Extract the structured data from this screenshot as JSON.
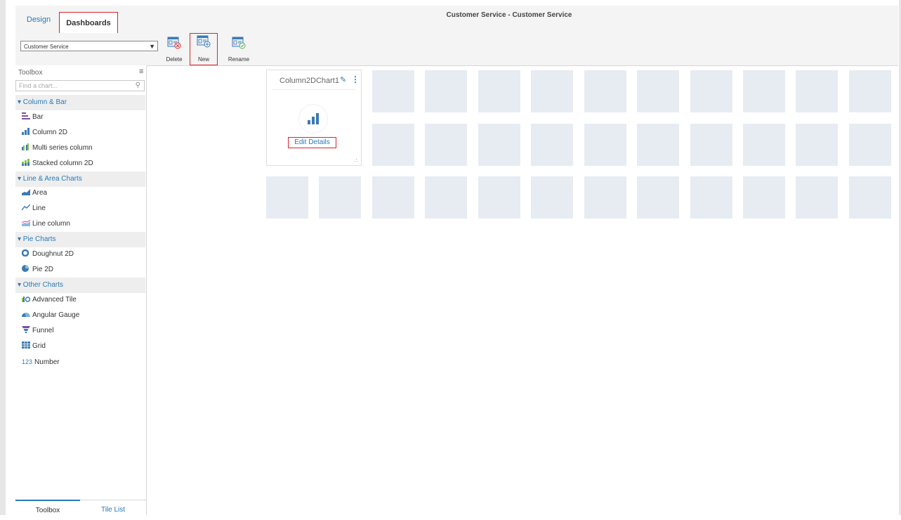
{
  "header": {
    "tabs": [
      {
        "label": "Design"
      },
      {
        "label": "Dashboards"
      }
    ],
    "title": "Customer Service - Customer Service"
  },
  "toolbar": {
    "dashboard_select": "Customer Service",
    "buttons": [
      {
        "label": "Delete"
      },
      {
        "label": "New"
      },
      {
        "label": "Rename"
      }
    ]
  },
  "sidebar": {
    "header": "Toolbox",
    "search_placeholder": "Find a chart...",
    "groups": [
      {
        "label": "▾ Column & Bar",
        "items": [
          {
            "label": "Bar",
            "icon": "bar-chart-icon"
          },
          {
            "label": "Column 2D",
            "icon": "column-chart-icon"
          },
          {
            "label": "Multi series column",
            "icon": "multi-series-column-icon"
          },
          {
            "label": "Stacked column 2D",
            "icon": "stacked-column-icon"
          }
        ]
      },
      {
        "label": "▾ Line & Area Charts",
        "items": [
          {
            "label": "Area",
            "icon": "area-chart-icon"
          },
          {
            "label": "Line",
            "icon": "line-chart-icon"
          },
          {
            "label": "Line column",
            "icon": "line-column-icon"
          }
        ]
      },
      {
        "label": "▾ Pie Charts",
        "items": [
          {
            "label": "Doughnut 2D",
            "icon": "doughnut-chart-icon"
          },
          {
            "label": "Pie 2D",
            "icon": "pie-chart-icon"
          }
        ]
      },
      {
        "label": "▾ Other Charts",
        "items": [
          {
            "label": "Advanced Tile",
            "icon": "advanced-tile-icon"
          },
          {
            "label": "Angular Gauge",
            "icon": "gauge-icon"
          },
          {
            "label": "Funnel",
            "icon": "funnel-icon"
          },
          {
            "label": "Grid",
            "icon": "grid-icon"
          },
          {
            "label": "Number",
            "icon": "number-icon"
          }
        ]
      }
    ],
    "number_glyph": "123",
    "bottom_tabs": [
      {
        "label": "Toolbox"
      },
      {
        "label": "Tile List"
      }
    ]
  },
  "canvas": {
    "card": {
      "title": "Column2DChart1",
      "edit_label": "Edit Details"
    }
  },
  "colors": {
    "accent": "#2a7ab8",
    "highlight": "#d9242b",
    "tile": "#e7ecf3"
  }
}
